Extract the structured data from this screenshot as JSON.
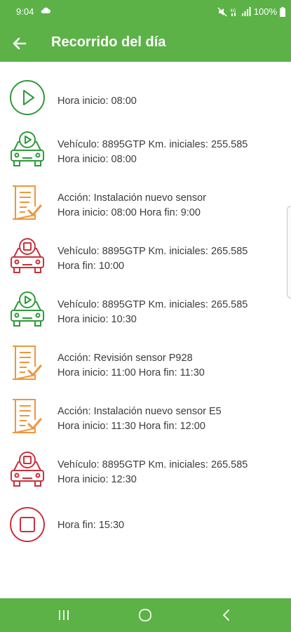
{
  "status": {
    "time": "9:04",
    "battery": "100%"
  },
  "header": {
    "title": "Recorrido del día"
  },
  "entries": [
    {
      "icon": "play-circle-icon",
      "color": "#2f9a3a",
      "line1": "Hora inicio: 08:00",
      "line2": ""
    },
    {
      "icon": "car-play-icon",
      "color": "#2f9a3a",
      "line1": "Vehículo: 8895GTP Km. iniciales: 255.585",
      "line2": "Hora inicio: 08:00"
    },
    {
      "icon": "checklist-icon",
      "color": "#f0963a",
      "line1": "Acción: Instalación nuevo sensor",
      "line2": "Hora inicio: 08:00 Hora fin: 9:00"
    },
    {
      "icon": "car-stop-icon",
      "color": "#c8323c",
      "line1": "Vehículo: 8895GTP Km. iniciales: 265.585",
      "line2": "Hora fin: 10:00"
    },
    {
      "icon": "car-play-icon",
      "color": "#2f9a3a",
      "line1": "Vehículo: 8895GTP Km. iniciales: 265.585",
      "line2": "Hora inicio: 10:30"
    },
    {
      "icon": "checklist-icon",
      "color": "#f0963a",
      "line1": "Acción: Revisión sensor P928",
      "line2": "Hora inicio: 11:00 Hora fin: 11:30"
    },
    {
      "icon": "checklist-icon",
      "color": "#f0963a",
      "line1": "Acción: Instalación nuevo sensor E5",
      "line2": "Hora inicio: 11:30 Hora fin: 12:00"
    },
    {
      "icon": "car-stop-icon",
      "color": "#c8323c",
      "line1": "Vehículo: 8895GTP Km. iniciales: 265.585",
      "line2": "Hora inicio: 12:30"
    },
    {
      "icon": "stop-circle-icon",
      "color": "#c8323c",
      "line1": "Hora fin: 15:30",
      "line2": ""
    }
  ],
  "colors": {
    "primary": "#5cb247",
    "start": "#2f9a3a",
    "action": "#f0963a",
    "stop": "#c8323c"
  }
}
